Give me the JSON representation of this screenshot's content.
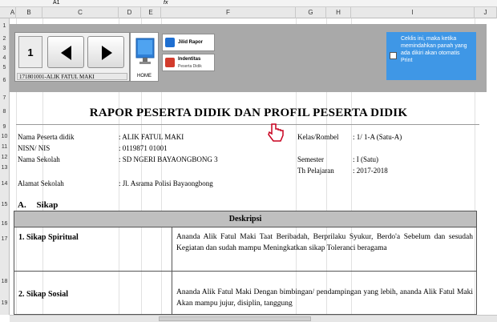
{
  "formula_bar": {
    "cell_ref": "A1",
    "fx_label": "fx"
  },
  "columns": [
    "A",
    "B",
    "C",
    "D",
    "E",
    "F",
    "G",
    "H",
    "I",
    "J"
  ],
  "rows": [
    "1",
    "2",
    "3",
    "4",
    "5",
    "6",
    "7",
    "8",
    "9",
    "10",
    "11",
    "12",
    "13",
    "14",
    "15",
    "16",
    "17",
    "18",
    "19"
  ],
  "control_panel": {
    "page_number": "1",
    "prev_icon": "triangle-left-icon",
    "next_icon": "triangle-right-icon",
    "student_selector": "171801001-ALIK FATUL MAKI",
    "home_label": "HOME",
    "jilid_rapor_label": "Jilid Rapor",
    "identitas_label": "Indentitas",
    "identitas_sub": "Peserta Didik",
    "info_text": "Ceklis ini, maka ketika memindahkan panah yang ada dikiri akan otomatis Print"
  },
  "report": {
    "title": "RAPOR PESERTA DIDIK DAN PROFIL PESERTA DIDIK",
    "fields": {
      "nama_label": "Nama Peserta didik",
      "nama_value": ": ALIK FATUL MAKI",
      "nisn_label": "NISN/ NIS",
      "nisn_value": ": 0119871       01001",
      "sekolah_label": "Nama Sekolah",
      "sekolah_value": ": SD NGERI BAYAONGBONG 3",
      "alamat_label": "Alamat Sekolah",
      "alamat_value": ": Jl. Asrama Polisi Bayaongbong",
      "kelas_label": "Kelas/Rombel",
      "kelas_value": ": 1/ 1-A (Satu-A)",
      "semester_label": "Semester",
      "semester_value": ": I (Satu)",
      "tahun_label": "Th Pelajaran",
      "tahun_value": ": 2017-2018"
    },
    "section_letter": "A.",
    "section_title": "Sikap",
    "table_header": "Deskripsi",
    "rows": [
      {
        "label": "1. Sikap Spiritual",
        "text": "Ananda Alik Fatul Maki Taat Beribadah, Berprilaku Syukur, Berdo'a Sebelum dan sesudah Kegiatan dan sudah mampu Meningkatkan sikap Toleranci beragama"
      },
      {
        "label": "2. Sikap Sosial",
        "text": "Ananda Alik Fatul Maki  Dengan bimbingan/ pendampingan yang lebih, ananda Alik Fatul Maki Akan mampu jujur, disiplin, tanggung"
      }
    ]
  }
}
